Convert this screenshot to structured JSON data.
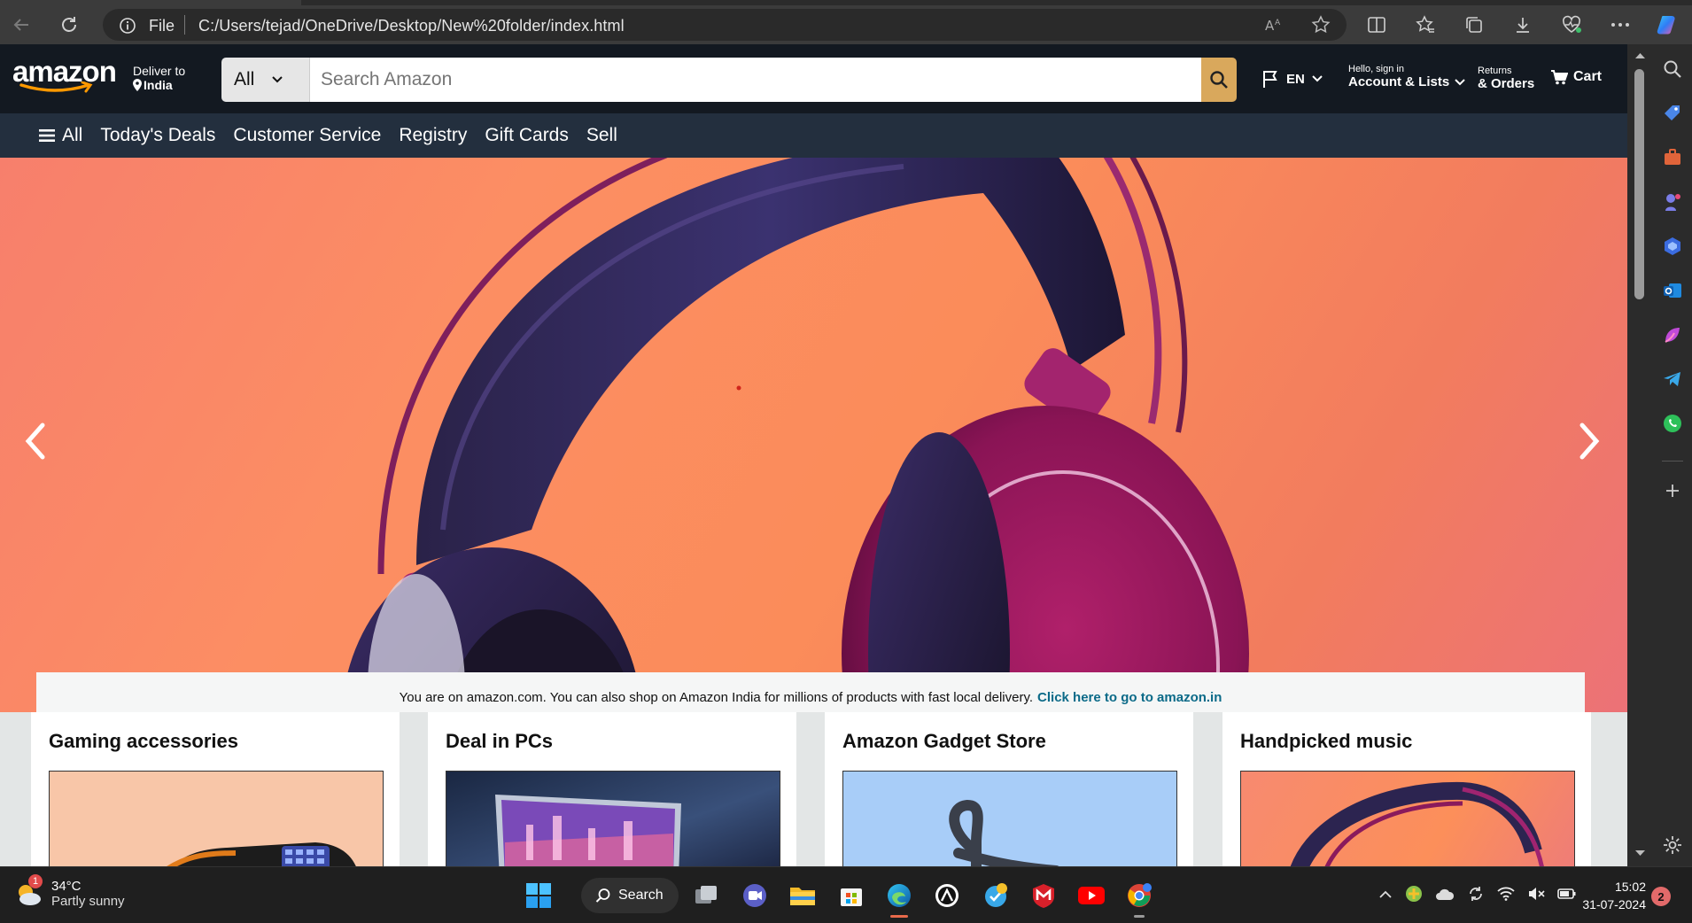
{
  "browser": {
    "scheme_label": "File",
    "url": "C:/Users/tejad/OneDrive/Desktop/New%20folder/index.html"
  },
  "header": {
    "logo_text": "amazon",
    "deliver_line1": "Deliver to",
    "deliver_line2": "India",
    "search_category": "All",
    "search_placeholder": "Search Amazon",
    "language": "EN",
    "account_line1": "Hello, sign in",
    "account_line2": "Account & Lists",
    "orders_line1": "Returns",
    "orders_line2": "& Orders",
    "cart_label": "Cart"
  },
  "nav": {
    "all_label": "All",
    "items": [
      "Today's Deals",
      "Customer Service",
      "Registry",
      "Gift Cards",
      "Sell"
    ]
  },
  "banner": {
    "text": "You are on amazon.com. You can also shop on Amazon India for millions of products with fast local delivery.",
    "link": "Click here to go to amazon.in"
  },
  "cards": [
    {
      "title": "Gaming accessories"
    },
    {
      "title": "Deal in PCs"
    },
    {
      "title": "Amazon Gadget Store"
    },
    {
      "title": "Handpicked music"
    }
  ],
  "taskbar": {
    "weather_temp": "34°C",
    "weather_desc": "Partly sunny",
    "weather_badge": "1",
    "search_label": "Search",
    "time": "15:02",
    "date": "31-07-2024",
    "notification_count": "2"
  },
  "colors": {
    "amazon_dark": "#131921",
    "amazon_nav": "#232f3e",
    "search_button": "#febd69",
    "link": "#0b6a88"
  }
}
